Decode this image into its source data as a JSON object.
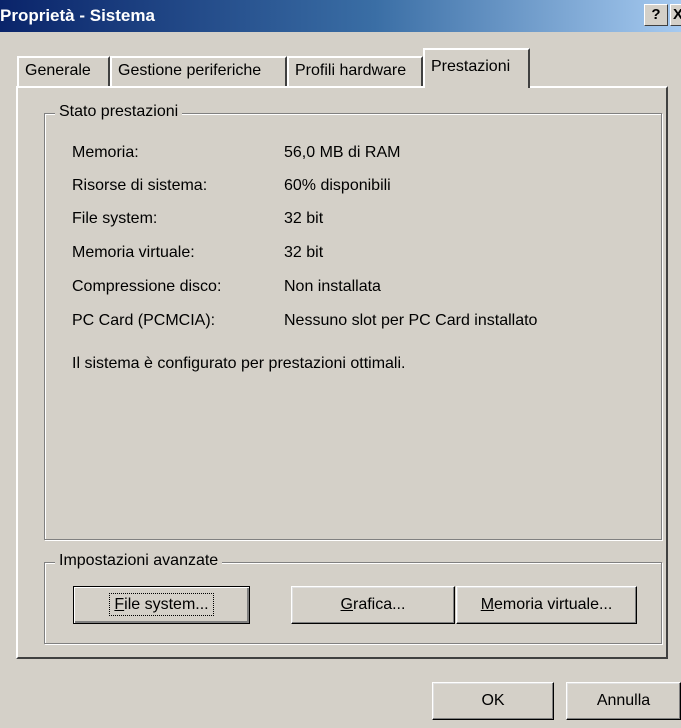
{
  "window": {
    "title": "Proprietà - Sistema",
    "help_button": "?",
    "close_button": "X"
  },
  "tabs": [
    {
      "label": "Generale"
    },
    {
      "label": "Gestione periferiche"
    },
    {
      "label": "Profili hardware"
    },
    {
      "label": "Prestazioni",
      "active": true
    }
  ],
  "performance_status": {
    "group_title": "Stato prestazioni",
    "rows": [
      {
        "label": "Memoria:",
        "value": "56,0 MB di RAM"
      },
      {
        "label": "Risorse di sistema:",
        "value": "60% disponibili"
      },
      {
        "label": "File system:",
        "value": "32 bit"
      },
      {
        "label": "Memoria virtuale:",
        "value": "32 bit"
      },
      {
        "label": "Compressione disco:",
        "value": "Non installata"
      },
      {
        "label": "PC Card (PCMCIA):",
        "value": "Nessuno slot per PC Card installato"
      }
    ],
    "message": "Il sistema è configurato per prestazioni ottimali."
  },
  "advanced": {
    "group_title": "Impostazioni avanzate",
    "buttons": {
      "file_system": {
        "mnemonic": "F",
        "rest": "ile system..."
      },
      "grafica": {
        "mnemonic": "G",
        "rest": "rafica..."
      },
      "memoria_virtuale": {
        "mnemonic": "M",
        "rest": "emoria virtuale..."
      }
    }
  },
  "footer": {
    "ok_label": "OK",
    "cancel_label": "Annulla"
  }
}
